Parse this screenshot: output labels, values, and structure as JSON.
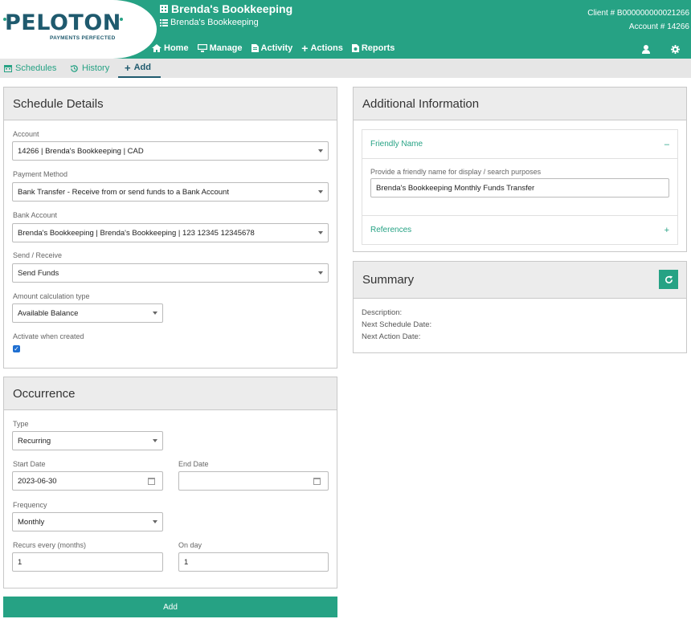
{
  "logo": {
    "name": "PELOTON",
    "tagline": "PAYMENTS PERFECTED"
  },
  "header": {
    "title": "Brenda's Bookkeeping",
    "subtitle": "Brenda's Bookkeeping",
    "client_label": "Client #",
    "client_value": "B000000000021266",
    "account_label": "Account #",
    "account_value": "14266"
  },
  "nav": [
    {
      "label": "Home",
      "icon": "home-icon"
    },
    {
      "label": "Manage",
      "icon": "monitor-icon"
    },
    {
      "label": "Activity",
      "icon": "document-icon"
    },
    {
      "label": "Actions",
      "icon": "plus-icon"
    },
    {
      "label": "Reports",
      "icon": "report-icon"
    }
  ],
  "subtabs": [
    {
      "label": "Schedules",
      "icon": "calendar-icon"
    },
    {
      "label": "History",
      "icon": "history-icon"
    },
    {
      "label": "Add",
      "icon": "plus-icon"
    }
  ],
  "schedule": {
    "title": "Schedule Details",
    "account_label": "Account",
    "account_value": "14266 | Brenda's Bookkeeping | CAD",
    "payment_method_label": "Payment Method",
    "payment_method_value": "Bank Transfer - Receive from or send funds to a Bank Account",
    "bank_account_label": "Bank Account",
    "bank_account_value": "Brenda's Bookkeeping | Brenda's Bookkeeping | 123 12345 12345678",
    "send_receive_label": "Send / Receive",
    "send_receive_value": "Send Funds",
    "amount_calc_label": "Amount calculation type",
    "amount_calc_value": "Available Balance",
    "activate_label": "Activate when created",
    "activate_checked": true
  },
  "occurrence": {
    "title": "Occurrence",
    "type_label": "Type",
    "type_value": "Recurring",
    "start_label": "Start Date",
    "start_value": "2023-06-30",
    "end_label": "End Date",
    "end_value": "",
    "frequency_label": "Frequency",
    "frequency_value": "Monthly",
    "recurs_label": "Recurs every (months)",
    "recurs_value": "1",
    "onday_label": "On day",
    "onday_value": "1"
  },
  "add_button": "Add",
  "additional": {
    "title": "Additional Information",
    "friendly_name_header": "Friendly Name",
    "friendly_name_toggle": "–",
    "friendly_name_hint": "Provide a friendly name for display / search purposes",
    "friendly_name_value": "Brenda's Bookkeeping Monthly Funds Transfer",
    "references_header": "References",
    "references_toggle": "+"
  },
  "summary": {
    "title": "Summary",
    "description_label": "Description:",
    "next_schedule_label": "Next Schedule Date:",
    "next_action_label": "Next Action Date:"
  },
  "colors": {
    "brand": "#26a284",
    "dark": "#1f5a6e"
  }
}
